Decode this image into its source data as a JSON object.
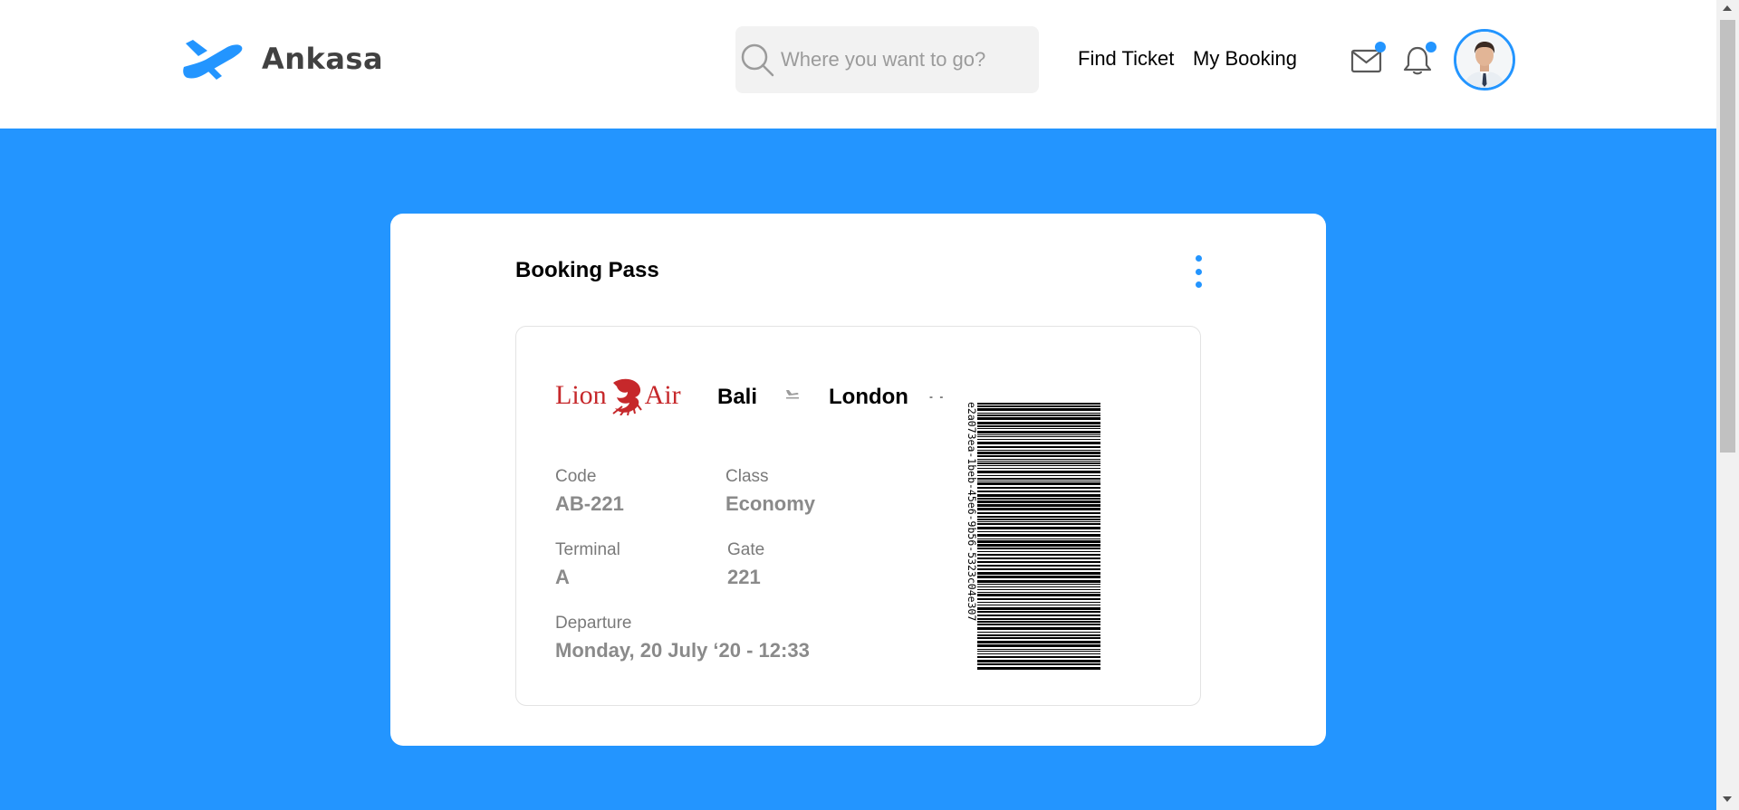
{
  "brand": {
    "name": "Ankasa",
    "logo_icon": "plane-icon"
  },
  "search": {
    "placeholder": "Where you want to go?",
    "value": ""
  },
  "nav": {
    "find_ticket": "Find Ticket",
    "my_booking": "My Booking"
  },
  "header_icons": {
    "mail": "mail-icon",
    "bell": "bell-icon",
    "avatar": "user-avatar"
  },
  "colors": {
    "accent": "#2395ff",
    "airline": "#c6282b",
    "label": "#7a7a7a",
    "value": "#8a8a8a"
  },
  "card": {
    "title": "Booking Pass",
    "menu_icon": "more-vertical-icon",
    "ticket": {
      "airline_logo": {
        "left": "Lion",
        "right": "Air"
      },
      "from": "Bali",
      "to": "London",
      "separator": "- -",
      "fields": {
        "code": {
          "label": "Code",
          "value": "AB-221"
        },
        "class": {
          "label": "Class",
          "value": "Economy"
        },
        "terminal": {
          "label": "Terminal",
          "value": "A"
        },
        "gate": {
          "label": "Gate",
          "value": "221"
        },
        "departure": {
          "label": "Departure",
          "value": "Monday, 20 July ‘20 - 12:33"
        }
      },
      "barcode_text": "e2a073ea-1beb-45e6-9b56-5323c04e307"
    }
  }
}
